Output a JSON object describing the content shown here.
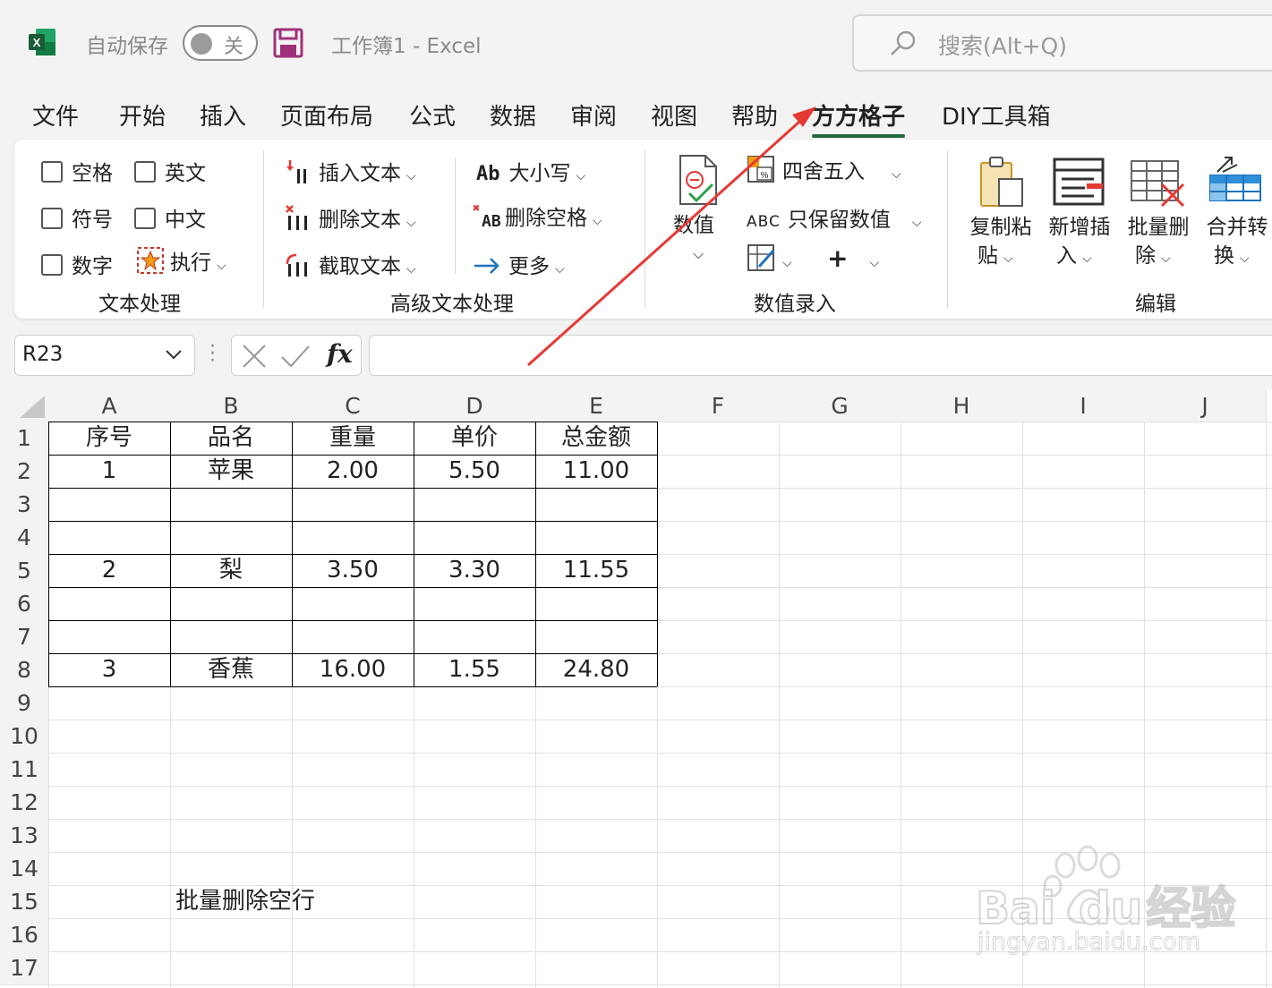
{
  "titlebar": {
    "autosave_label": "自动保存",
    "toggle_state": "关",
    "doc_title": "工作簿1  -  Excel",
    "search_placeholder": "搜索(Alt+Q)"
  },
  "tabs": [
    "文件",
    "开始",
    "插入",
    "页面布局",
    "公式",
    "数据",
    "审阅",
    "视图",
    "帮助",
    "方方格子",
    "DIY工具箱"
  ],
  "active_tab": "方方格子",
  "ribbon": {
    "text_processing": {
      "checkboxes": [
        "空格",
        "英文",
        "符号",
        "中文",
        "数字"
      ],
      "execute": "执行",
      "group_label": "文本处理"
    },
    "advanced_text": {
      "insert_text": "插入文本",
      "delete_text": "删除文本",
      "extract_text": "截取文本",
      "case": "大小写",
      "delete_spaces": "删除空格",
      "more": "更多",
      "group_label": "高级文本处理",
      "icon_letters_ab": "Ab",
      "icon_letters_AB": "AB"
    },
    "number_entry": {
      "numeric": "数值",
      "round": "四舍五入",
      "keep_numeric": "只保留数值",
      "group_label": "数值录入",
      "icon_letters_abc": "ABC"
    },
    "edit": {
      "copy_paste": [
        "复制粘",
        "贴"
      ],
      "add_insert": [
        "新增插",
        "入"
      ],
      "batch_delete": [
        "批量删",
        "除"
      ],
      "merge_convert": [
        "合并转",
        "换"
      ],
      "group_label": "编辑"
    }
  },
  "formula_bar": {
    "name_box": "R23",
    "formula": "",
    "fx_label": "fx"
  },
  "sheet": {
    "columns": [
      "A",
      "B",
      "C",
      "D",
      "E",
      "F",
      "G",
      "H",
      "I",
      "J"
    ],
    "rows": [
      "1",
      "2",
      "3",
      "4",
      "5",
      "6",
      "7",
      "8",
      "9",
      "10",
      "11",
      "12",
      "13",
      "14",
      "15",
      "16",
      "17"
    ],
    "header": [
      "序号",
      "品名",
      "重量",
      "单价",
      "总金额"
    ],
    "data_rows": [
      [
        "1",
        "苹果",
        "2.00",
        "5.50",
        "11.00"
      ],
      [
        "",
        "",
        "",
        "",
        ""
      ],
      [
        "",
        "",
        "",
        "",
        ""
      ],
      [
        "2",
        "梨",
        "3.50",
        "3.30",
        "11.55"
      ],
      [
        "",
        "",
        "",
        "",
        ""
      ],
      [
        "",
        "",
        "",
        "",
        ""
      ],
      [
        "3",
        "香蕉",
        "16.00",
        "1.55",
        "24.80"
      ]
    ],
    "note_B15": "批量删除空行"
  },
  "watermark": {
    "brand": "Bai",
    "brand_tail": "du",
    "brand_cn": "经验",
    "url": "jingyan.baidu.com"
  },
  "colors": {
    "excel_green": "#1d6f42",
    "active_tab_underline": "#1f6b3b",
    "annotation_arrow": "#e53935",
    "save_icon": "#a0307a"
  }
}
